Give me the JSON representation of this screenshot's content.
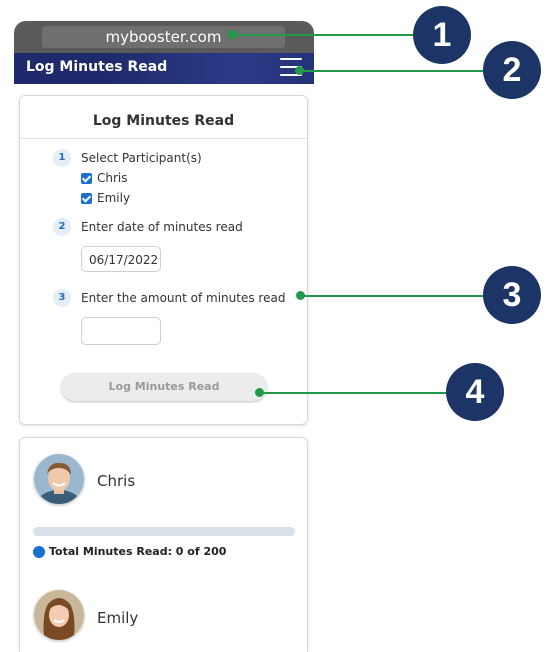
{
  "browser": {
    "url": "mybooster.com"
  },
  "header": {
    "title": "Log Minutes Read",
    "menu_icon": "hamburger-menu-icon"
  },
  "form": {
    "title": "Log Minutes Read",
    "steps": [
      {
        "num": "1",
        "label": "Select Participant(s)"
      },
      {
        "num": "2",
        "label": "Enter date of minutes read"
      },
      {
        "num": "3",
        "label": "Enter the amount of minutes read"
      }
    ],
    "participants": [
      {
        "name": "Chris",
        "checked": true
      },
      {
        "name": "Emily",
        "checked": true
      }
    ],
    "date_value": "06/17/2022",
    "minutes_value": "",
    "submit_label": "Log Minutes Read"
  },
  "people": [
    {
      "name": "Chris",
      "total_label": "Total Minutes Read: 0 of 200",
      "minutes_read": 0,
      "goal": 200
    },
    {
      "name": "Emily"
    }
  ],
  "callouts": [
    "1",
    "2",
    "3",
    "4"
  ],
  "colors": {
    "header": "#1e2a6b",
    "accent": "#1a6fd1",
    "callout": "#1c3566",
    "callout_line": "#1f9a4a"
  }
}
